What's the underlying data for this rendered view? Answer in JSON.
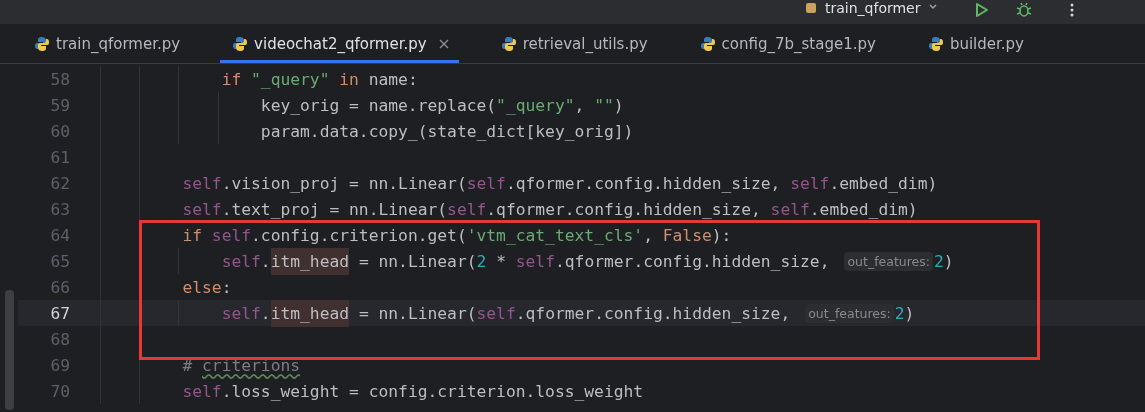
{
  "toolbar": {
    "run_config": "train_qformer"
  },
  "tabs": [
    {
      "label": "train_qformer.py",
      "selected": false
    },
    {
      "label": "videochat2_qformer.py",
      "selected": true
    },
    {
      "label": "retrieval_utils.py",
      "selected": false
    },
    {
      "label": "config_7b_stage1.py",
      "selected": false
    },
    {
      "label": "builder.py",
      "selected": false
    }
  ],
  "editor": {
    "lines": [
      {
        "number": "58",
        "current": false,
        "segments": [
          {
            "kind": "code",
            "tokens": [
              {
                "t": "            if ",
                "kind": "keyword"
              },
              {
                "t": "\"_query\" ",
                "kind": "string"
              },
              {
                "t": "in ",
                "kind": "keyword"
              },
              {
                "t": "name:",
                "kind": "plain"
              }
            ]
          }
        ]
      },
      {
        "number": "59",
        "current": false,
        "segments": [
          {
            "kind": "code",
            "tokens": [
              {
                "t": "                key_orig = name.replace(",
                "kind": "plain"
              },
              {
                "t": "\"_query\"",
                "kind": "string"
              },
              {
                "t": ", ",
                "kind": "plain"
              },
              {
                "t": "\"\"",
                "kind": "string"
              },
              {
                "t": ")",
                "kind": "plain"
              }
            ]
          }
        ]
      },
      {
        "number": "60",
        "current": false,
        "segments": [
          {
            "kind": "code",
            "tokens": [
              {
                "t": "                param.data.copy_(state_dict[key_orig])",
                "kind": "plain"
              }
            ]
          }
        ]
      },
      {
        "number": "61",
        "current": false
      },
      {
        "number": "62",
        "current": false,
        "segments": [
          {
            "kind": "code",
            "tokens": [
              {
                "t": "        self",
                "kind": "self"
              },
              {
                "t": ".vision_proj = nn.Linear(",
                "kind": "plain"
              },
              {
                "t": "self",
                "kind": "self"
              },
              {
                "t": ".qformer.config.hidden_size, ",
                "kind": "plain"
              },
              {
                "t": "self",
                "kind": "self"
              },
              {
                "t": ".embed_dim)",
                "kind": "plain"
              }
            ]
          }
        ]
      },
      {
        "number": "63",
        "current": false,
        "segments": [
          {
            "kind": "code",
            "tokens": [
              {
                "t": "        self",
                "kind": "self"
              },
              {
                "t": ".text_proj = nn.Linear(",
                "kind": "plain"
              },
              {
                "t": "self",
                "kind": "self"
              },
              {
                "t": ".qformer.config.hidden_size, ",
                "kind": "plain"
              },
              {
                "t": "self",
                "kind": "self"
              },
              {
                "t": ".embed_dim)",
                "kind": "plain"
              }
            ]
          }
        ]
      },
      {
        "number": "64",
        "current": false,
        "segments": [
          {
            "kind": "code",
            "tokens": [
              {
                "t": "        if ",
                "kind": "keyword"
              },
              {
                "t": "self",
                "kind": "self"
              },
              {
                "t": ".config.criterion.get(",
                "kind": "plain"
              },
              {
                "t": "'vtm_cat_text_cls'",
                "kind": "string"
              },
              {
                "t": ", ",
                "kind": "plain"
              },
              {
                "t": "False",
                "kind": "keyword"
              },
              {
                "t": "):",
                "kind": "plain"
              }
            ]
          }
        ]
      },
      {
        "number": "65",
        "current": false,
        "segments": [
          {
            "kind": "code",
            "tokens": [
              {
                "t": "            self",
                "kind": "self"
              },
              {
                "t": ".",
                "kind": "plain"
              },
              {
                "t": "itm_head",
                "kind": "reference"
              },
              {
                "t": " = nn.Linear(",
                "kind": "plain"
              },
              {
                "t": "2",
                "kind": "number"
              },
              {
                "t": " * ",
                "kind": "plain"
              },
              {
                "t": "self",
                "kind": "self"
              },
              {
                "t": ".qformer.config.hidden_size,",
                "kind": "plain"
              }
            ]
          },
          {
            "kind": "hint",
            "text": "out_features:"
          },
          {
            "kind": "code",
            "tokens": [
              {
                "t": "2",
                "kind": "number"
              },
              {
                "t": ")",
                "kind": "plain"
              }
            ]
          }
        ]
      },
      {
        "number": "66",
        "current": false,
        "segments": [
          {
            "kind": "code",
            "tokens": [
              {
                "t": "        else",
                "kind": "keyword"
              },
              {
                "t": ":",
                "kind": "plain"
              }
            ]
          }
        ]
      },
      {
        "number": "67",
        "current": true,
        "segments": [
          {
            "kind": "code",
            "tokens": [
              {
                "t": "            self",
                "kind": "self"
              },
              {
                "t": ".",
                "kind": "plain"
              },
              {
                "t": "itm_head",
                "kind": "reference"
              },
              {
                "t": " = nn.Linear(",
                "kind": "plain"
              },
              {
                "t": "self",
                "kind": "self"
              },
              {
                "t": ".qformer.config.hidden_size,",
                "kind": "plain"
              }
            ]
          },
          {
            "kind": "hint",
            "text": "out_features:"
          },
          {
            "kind": "code",
            "tokens": [
              {
                "t": "2",
                "kind": "number"
              },
              {
                "t": ")",
                "kind": "plain"
              }
            ]
          }
        ]
      },
      {
        "number": "68",
        "current": false
      },
      {
        "number": "69",
        "current": false,
        "segments": [
          {
            "kind": "code",
            "tokens": [
              {
                "t": "        # ",
                "kind": "comment"
              },
              {
                "t": "criterions",
                "kind": "typo"
              }
            ]
          }
        ]
      },
      {
        "number": "70",
        "current": false,
        "segments": [
          {
            "kind": "code",
            "tokens": [
              {
                "t": "        self",
                "kind": "self"
              },
              {
                "t": ".loss_weight = config.criterion.loss_weight",
                "kind": "plain"
              }
            ]
          }
        ]
      }
    ]
  }
}
